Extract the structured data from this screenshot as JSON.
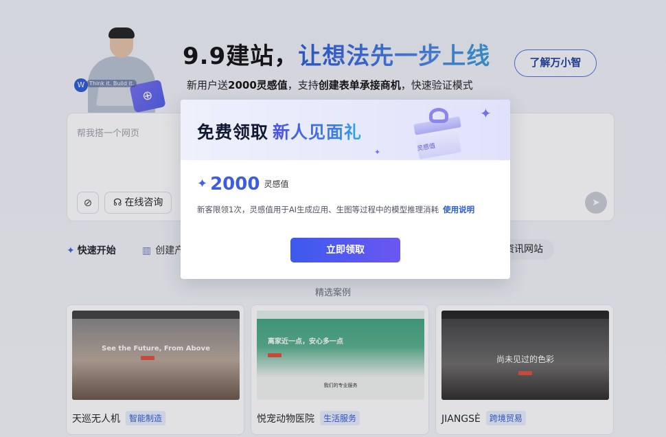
{
  "hero": {
    "person_tag": "Think it. Build it.",
    "title_black": "9.9建站，",
    "title_gradient": "让想法先一步上线",
    "subtitle_pre": "新用户送",
    "subtitle_b1": "2000灵感值",
    "subtitle_mid": "，支持",
    "subtitle_b2": "创建表单承接商机",
    "subtitle_post": "，快速验证模式",
    "learn_label": "了解万小智"
  },
  "prompt": {
    "placeholder": "帮我搭一个网页",
    "consult_label": "在线咨询"
  },
  "quick": {
    "start_label": "快速开始",
    "create_label": "创建产",
    "news_label": "资讯网站"
  },
  "cases": {
    "section_title": "精选案例",
    "items": [
      {
        "name": "天巡无人机",
        "tag": "智能制造",
        "thumb_text": "See the Future, From Above"
      },
      {
        "name": "悦宠动物医院",
        "tag": "生活服务",
        "thumb_text": "离家近一点，安心多一点",
        "thumb_sub": "我们的专业服务"
      },
      {
        "name": "JIANGSÈ",
        "tag": "跨境贸易",
        "thumb_text": "尚未见过的色彩"
      }
    ]
  },
  "modal": {
    "title_black": "免费领取",
    "title_gradient": "新人见面礼",
    "gift_label": "灵感值",
    "amount": "2000",
    "unit": "灵感值",
    "description": "新客限领1次，灵感值用于AI生成应用、生图等过程中的模型推理消耗",
    "link_label": "使用说明",
    "claim_label": "立即领取"
  },
  "colors": {
    "accent": "#3d5ddf",
    "button_gradient_start": "#3d59ee",
    "button_gradient_end": "#6a58f1",
    "tag_bg": "#e8eefc"
  },
  "icons": {
    "attach": "paperclip-icon",
    "consult": "headset-icon",
    "send": "send-icon",
    "quick_start": "sparkle-icon",
    "create": "building-icon"
  }
}
